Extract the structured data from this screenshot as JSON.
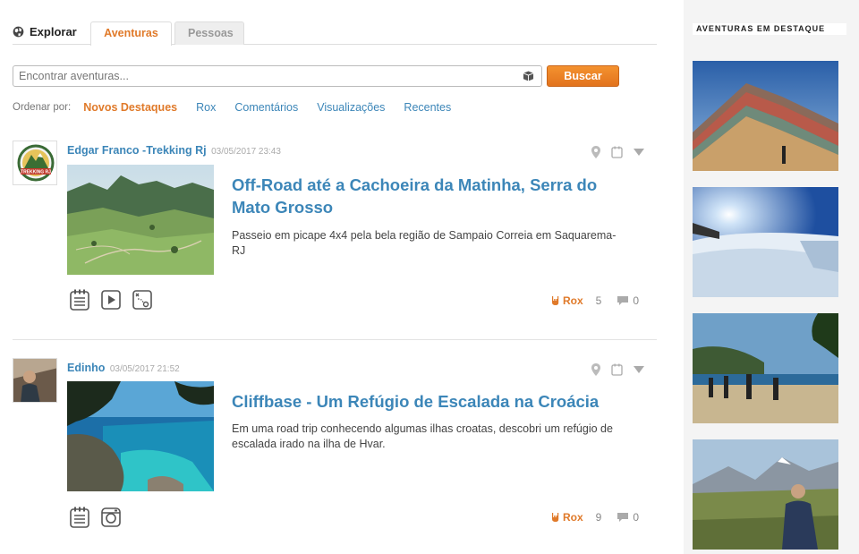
{
  "nav": {
    "explore_label": "Explorar",
    "tabs": [
      {
        "label": "Aventuras",
        "active": true
      },
      {
        "label": "Pessoas",
        "active": false
      }
    ]
  },
  "search": {
    "placeholder": "Encontrar aventuras...",
    "value": "",
    "button_label": "Buscar"
  },
  "sort": {
    "label": "Ordenar por:",
    "options": [
      {
        "label": "Novos Destaques",
        "active": true
      },
      {
        "label": "Rox",
        "active": false
      },
      {
        "label": "Comentários",
        "active": false
      },
      {
        "label": "Visualizações",
        "active": false
      },
      {
        "label": "Recentes",
        "active": false
      }
    ]
  },
  "posts": [
    {
      "author": "Edgar Franco -Trekking Rj",
      "date": "03/05/2017 23:43",
      "title": "Off-Road até a Cachoeira da Matinha, Serra do Mato Grosso",
      "description": "Passeio em picape 4x4 pela bela região de Sampaio Correia em Saquarema-RJ",
      "rox_label": "Rox",
      "rox_count": "5",
      "comment_count": "0",
      "avatar_text": "TREKKING RJ",
      "icons": [
        "calendar-list-icon",
        "play-icon",
        "route-map-icon"
      ]
    },
    {
      "author": "Edinho",
      "date": "03/05/2017 21:52",
      "title": "Cliffbase - Um Refúgio de Escalada na Croácia",
      "description": "Em uma road trip conhecendo algumas ilhas croatas, descobri um refúgio de escalada irado na ilha de Hvar.",
      "rox_label": "Rox",
      "rox_count": "9",
      "comment_count": "0",
      "icons": [
        "calendar-list-icon",
        "camera-icon"
      ]
    }
  ],
  "sidebar": {
    "heading": "AVENTURAS EM DESTAQUE"
  },
  "colors": {
    "accent_orange": "#e07a2a",
    "link_blue": "#3c86b8",
    "sidebar_bg": "#f4f4f4"
  }
}
